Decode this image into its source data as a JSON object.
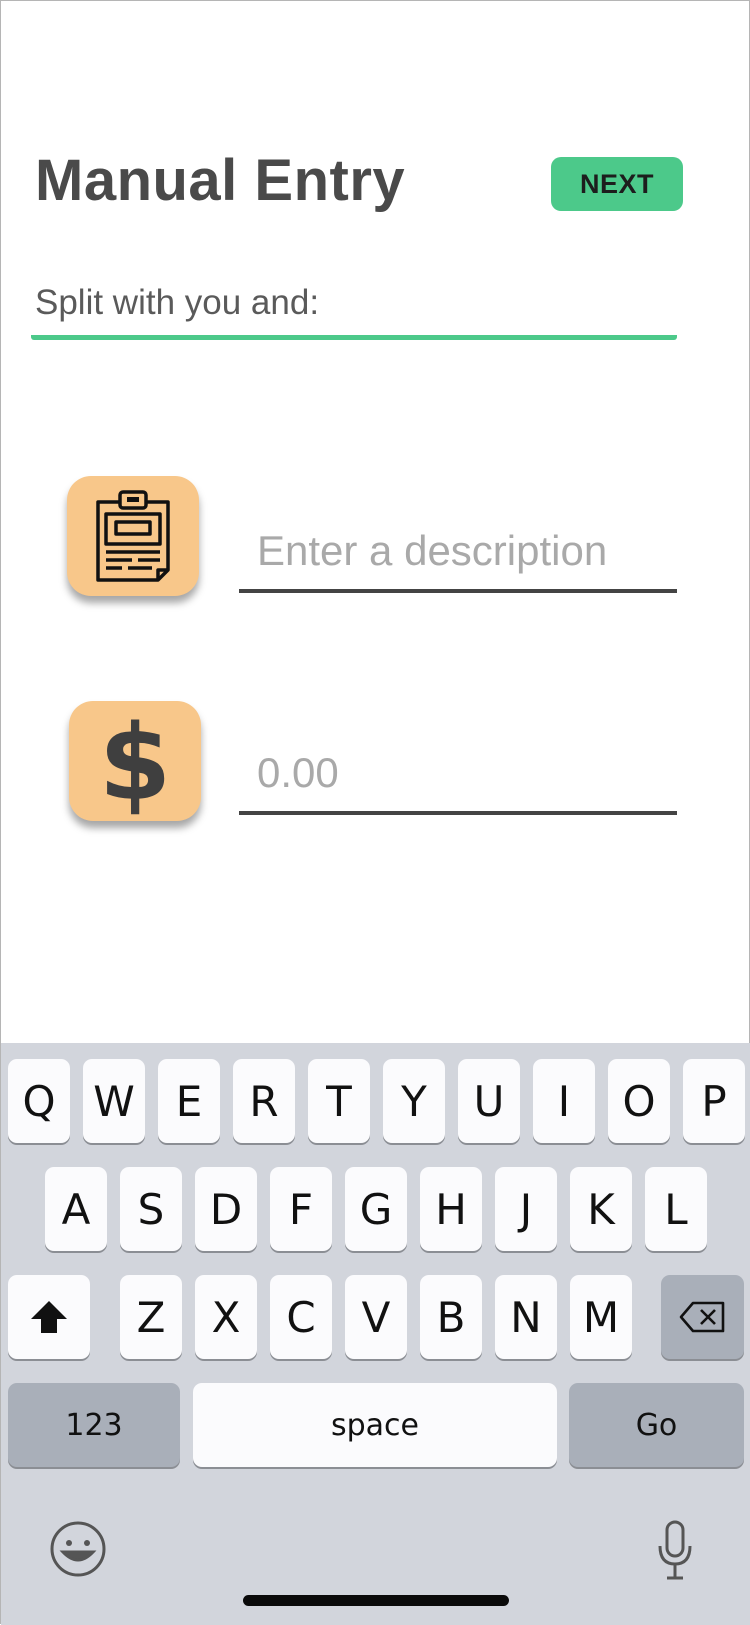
{
  "screen": {
    "title": "Manual Entry",
    "next_label": "NEXT",
    "split_label": "Split with you and:",
    "description_placeholder": "Enter a description",
    "amount_placeholder": "0.00",
    "currency_symbol": "$",
    "icons": {
      "description": "clipboard-icon",
      "amount": "dollar-icon"
    },
    "colors": {
      "accent": "#4cc98a",
      "tile": "#f8c78a",
      "title": "#4a4a4a"
    }
  },
  "keyboard": {
    "row1": [
      "Q",
      "W",
      "E",
      "R",
      "T",
      "Y",
      "U",
      "I",
      "O",
      "P"
    ],
    "row2": [
      "A",
      "S",
      "D",
      "F",
      "G",
      "H",
      "J",
      "K",
      "L"
    ],
    "row3": [
      "Z",
      "X",
      "C",
      "V",
      "B",
      "N",
      "M"
    ],
    "shift_icon": "shift-icon",
    "backspace_icon": "backspace-icon",
    "numbers_label": "123",
    "space_label": "space",
    "go_label": "Go",
    "emoji_icon": "emoji-icon",
    "mic_icon": "microphone-icon"
  }
}
